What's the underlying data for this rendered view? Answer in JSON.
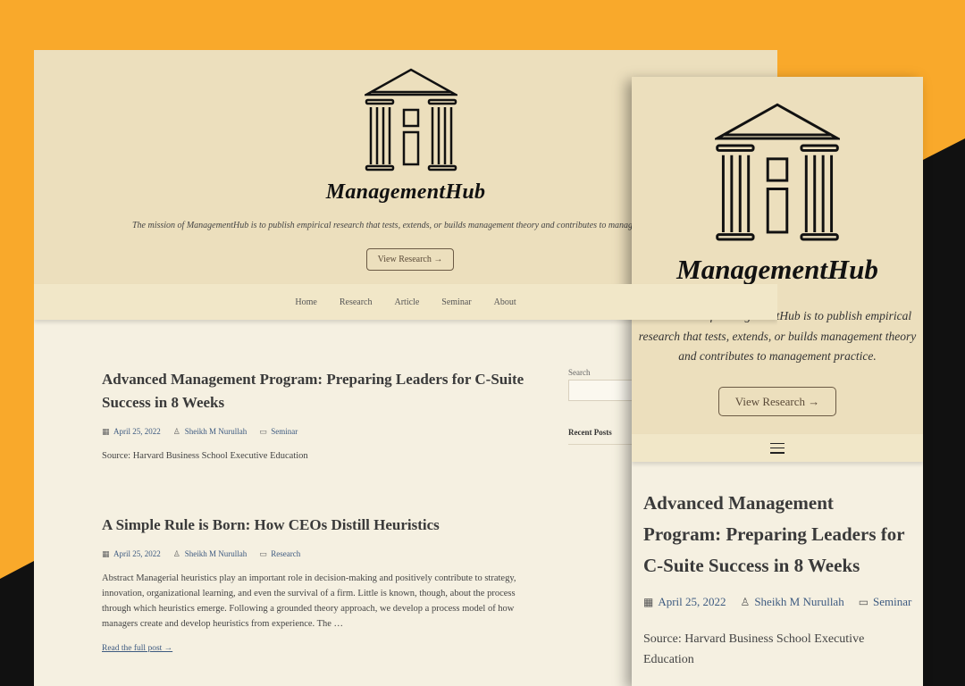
{
  "site": {
    "name": "ManagementHub",
    "mission": "The mission of ManagementHub is to publish empirical research that tests, extends, or builds management theory and contributes to management practice.",
    "mission_desktop_visible": "The mission of ManagementHub is to publish empirical research that tests, extends, or builds management theory and contributes to manag",
    "cta_label": "View Research →"
  },
  "nav": {
    "items": [
      {
        "label": "Home"
      },
      {
        "label": "Research"
      },
      {
        "label": "Article"
      },
      {
        "label": "Seminar"
      },
      {
        "label": "About"
      }
    ]
  },
  "posts": [
    {
      "title": "Advanced Management Program: Preparing Leaders for C-Suite Success in 8 Weeks",
      "date": "April 25, 2022",
      "author": "Sheikh M Nurullah",
      "category": "Seminar",
      "excerpt": "Source: Harvard Business School Executive Education"
    },
    {
      "title": "A Simple Rule is Born: How CEOs Distill Heuristics",
      "date": "April 25, 2022",
      "author": "Sheikh M Nurullah",
      "category": "Research",
      "excerpt": "Abstract Managerial heuristics play an important role in decision-making and positively contribute to strategy, innovation, organizational learning, and even the survival of a firm. Little is known, though, about the process through which heuristics emerge. Following a grounded theory approach, we develop a process model of how managers create and develop heuristics from experience. The …",
      "read_more": "Read the full post →"
    }
  ],
  "sidebar": {
    "search_label": "Search",
    "recent_posts_label": "Recent Posts"
  },
  "icons": {
    "logo": "pillared-building-icon",
    "date": "calendar-icon",
    "author": "user-icon",
    "category": "folder-icon",
    "menu": "hamburger-menu-icon"
  },
  "colors": {
    "background_accent": "#f9a92b",
    "hero": "#ecdfbd",
    "link": "#3d5a80"
  }
}
